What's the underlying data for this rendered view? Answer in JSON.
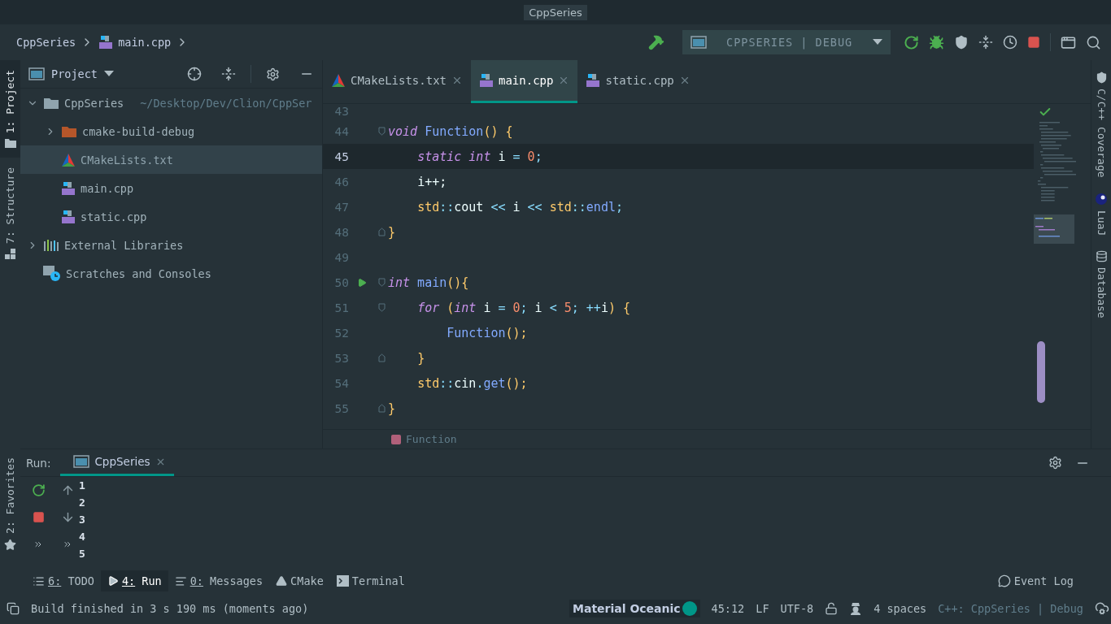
{
  "window": {
    "title": "CppSeries"
  },
  "breadcrumbs": [
    {
      "label": "CppSeries",
      "kind": "project"
    },
    {
      "label": "main.cpp",
      "kind": "cpp"
    }
  ],
  "run_config": {
    "label": "CPPSERIES | DEBUG"
  },
  "left_strip": {
    "top": [
      {
        "label": "1: Project",
        "selected": true,
        "kind": "folder"
      },
      {
        "label": "7: Structure",
        "selected": false,
        "kind": "structure"
      }
    ],
    "bottom": [
      {
        "label": "2: Favorites",
        "selected": false,
        "kind": "star"
      }
    ]
  },
  "project": {
    "title": "Project",
    "tree": [
      {
        "name": "CppSeries",
        "path": "~/Desktop/Dev/Clion/CppSer",
        "kind": "folder",
        "expanded": true,
        "selected": false,
        "children": [
          {
            "name": "cmake-build-debug",
            "kind": "build",
            "expanded": false,
            "selected": false
          },
          {
            "name": "CMakeLists.txt",
            "kind": "cmake",
            "selected": true
          },
          {
            "name": "main.cpp",
            "kind": "cpp",
            "selected": false
          },
          {
            "name": "static.cpp",
            "kind": "cpp",
            "selected": false
          }
        ]
      },
      {
        "name": "External Libraries",
        "kind": "libraries",
        "expanded": false,
        "selected": false
      },
      {
        "name": "Scratches and Consoles",
        "kind": "scratches",
        "selected": false
      }
    ]
  },
  "editor_tabs": [
    {
      "label": "CMakeLists.txt",
      "kind": "cmake",
      "selected": false
    },
    {
      "label": "main.cpp",
      "kind": "cpp",
      "selected": true
    },
    {
      "label": "static.cpp",
      "kind": "cpp",
      "selected": false
    }
  ],
  "code": [
    {
      "number": "43",
      "current": false
    },
    {
      "number": "44",
      "current": false,
      "fold_open": true,
      "tokens": [
        {
          "color": "#c792ea",
          "italic": true,
          "t": "void"
        },
        {
          "color": "#82aaff",
          "t": " Function"
        },
        {
          "color": "#ffcb6b",
          "t": "() {"
        }
      ]
    },
    {
      "number": "45",
      "current": true,
      "tokens": [
        {
          "color": "#c792ea",
          "italic": true,
          "t": "    static int"
        },
        {
          "color": "#eeffff",
          "t": " i "
        },
        {
          "color": "#89ddff",
          "t": "="
        },
        {
          "color": "#f78c6c",
          "t": " 0"
        },
        {
          "color": "#89ddff",
          "t": ";"
        }
      ]
    },
    {
      "number": "46",
      "current": false,
      "tokens": [
        {
          "color": "#eeffff",
          "t": "    i++;"
        }
      ]
    },
    {
      "number": "47",
      "current": false,
      "tokens": [
        {
          "color": "#ffcb6b",
          "t": "    std"
        },
        {
          "color": "#89ddff",
          "t": "::"
        },
        {
          "color": "#eeffff",
          "t": "cout "
        },
        {
          "color": "#89ddff",
          "t": "<<"
        },
        {
          "color": "#eeffff",
          "t": " i "
        },
        {
          "color": "#89ddff",
          "t": "<<"
        },
        {
          "color": "#ffcb6b",
          "t": " std"
        },
        {
          "color": "#89ddff",
          "t": "::"
        },
        {
          "color": "#82aaff",
          "t": "endl"
        },
        {
          "color": "#89ddff",
          "t": ";"
        }
      ]
    },
    {
      "number": "48",
      "current": false,
      "fold_close": true,
      "tokens": [
        {
          "color": "#ffcb6b",
          "t": "}"
        }
      ]
    },
    {
      "number": "49",
      "current": false
    },
    {
      "number": "50",
      "current": false,
      "fold_open": true,
      "run": true,
      "tokens": [
        {
          "color": "#c792ea",
          "italic": true,
          "t": "int"
        },
        {
          "color": "#82aaff",
          "t": " main"
        },
        {
          "color": "#ffcb6b",
          "t": "(){"
        }
      ]
    },
    {
      "number": "51",
      "current": false,
      "fold_open": true,
      "tokens": [
        {
          "color": "#c792ea",
          "italic": true,
          "t": "    for"
        },
        {
          "color": "#ffcb6b",
          "t": " ("
        },
        {
          "color": "#c792ea",
          "italic": true,
          "t": "int"
        },
        {
          "color": "#eeffff",
          "t": " i "
        },
        {
          "color": "#89ddff",
          "t": "="
        },
        {
          "color": "#f78c6c",
          "t": " 0"
        },
        {
          "color": "#89ddff",
          "t": ";"
        },
        {
          "color": "#eeffff",
          "t": " i "
        },
        {
          "color": "#89ddff",
          "t": "<"
        },
        {
          "color": "#f78c6c",
          "t": " 5"
        },
        {
          "color": "#89ddff",
          "t": "; ++"
        },
        {
          "color": "#eeffff",
          "t": "i"
        },
        {
          "color": "#ffcb6b",
          "t": ") {"
        }
      ]
    },
    {
      "number": "52",
      "current": false,
      "tokens": [
        {
          "color": "#82aaff",
          "t": "        Function"
        },
        {
          "color": "#ffcb6b",
          "t": "();"
        }
      ]
    },
    {
      "number": "53",
      "current": false,
      "fold_close": true,
      "tokens": [
        {
          "color": "#ffcb6b",
          "t": "    }"
        }
      ]
    },
    {
      "number": "54",
      "current": false,
      "tokens": [
        {
          "color": "#ffcb6b",
          "t": "    std"
        },
        {
          "color": "#89ddff",
          "t": "::"
        },
        {
          "color": "#eeffff",
          "t": "cin"
        },
        {
          "color": "#89ddff",
          "t": "."
        },
        {
          "color": "#82aaff",
          "t": "get"
        },
        {
          "color": "#ffcb6b",
          "t": "();"
        }
      ]
    },
    {
      "number": "55",
      "current": false,
      "fold_close": true,
      "tokens": [
        {
          "color": "#ffcb6b",
          "t": "}"
        }
      ]
    }
  ],
  "editor_breadcrumb": {
    "label": "Function"
  },
  "right_strip": [
    {
      "label": "C/C++ Coverage",
      "kind": "shield"
    },
    {
      "label": "LuaJ",
      "kind": "lua"
    },
    {
      "label": "Database",
      "kind": "database"
    }
  ],
  "run_panel": {
    "label": "Run:",
    "tabs": [
      {
        "label": "CppSeries",
        "selected": true
      }
    ],
    "output": [
      "1",
      "2",
      "3",
      "4",
      "5"
    ]
  },
  "tool_windows": [
    {
      "label": "6: TODO",
      "kind": "todo",
      "selected": false
    },
    {
      "label": "4: Run",
      "kind": "run",
      "selected": true
    },
    {
      "label": "0: Messages",
      "kind": "messages",
      "selected": false
    },
    {
      "label": "CMake",
      "kind": "cmake",
      "selected": false
    },
    {
      "label": "Terminal",
      "kind": "terminal",
      "selected": false
    }
  ],
  "event_log": {
    "label": "Event Log"
  },
  "status_bar": {
    "message": "Build finished in 3 s 190 ms (moments ago)",
    "theme": "Material Oceanic",
    "position": "45:12",
    "line_ending": "LF",
    "encoding": "UTF-8",
    "indent": "4 spaces",
    "context": "C++: CppSeries | Debug"
  }
}
